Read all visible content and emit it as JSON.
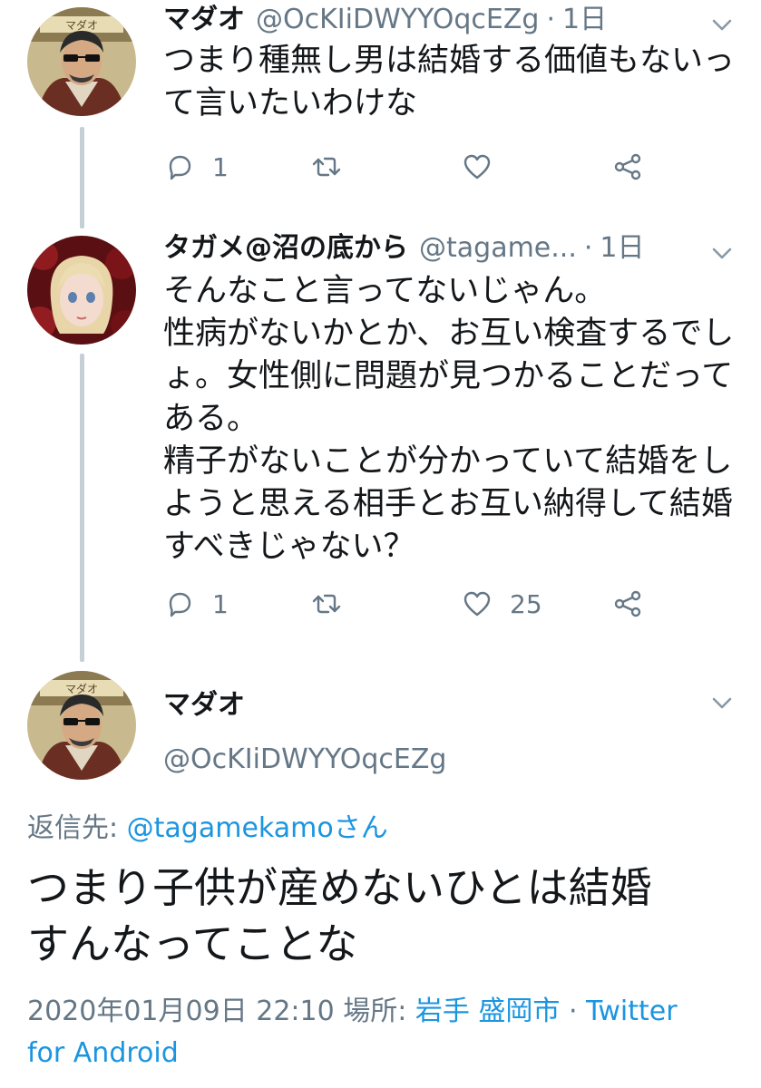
{
  "tweets": [
    {
      "name": "マダオ",
      "handle": "@OcKIiDWYYOqcEZg",
      "time": "1日",
      "lines": [
        "つまり種無し男は結婚する価値もないっ",
        "て言いたいわけな"
      ],
      "replies": "1",
      "likes": ""
    },
    {
      "name": "タガメ@沼の底から",
      "handle": "@tagame...",
      "time": "1日",
      "lines": [
        "そんなこと言ってないじゃん。",
        "性病がないかとか、お互い検査するでし",
        "ょ。女性側に問題が見つかることだって",
        "ある。",
        "精子がないことが分かっていて結婚をし",
        "ようと思える相手とお互い納得して結婚",
        "すべきじゃない？"
      ],
      "replies": "1",
      "likes": "25"
    }
  ],
  "main_tweet": {
    "name": "マダオ",
    "handle": "@OcKIiDWYYOqcEZg",
    "reply_label": "返信先: ",
    "reply_target": "@tagamekamoさん",
    "lines": [
      "つまり子供が産めないひとは結婚",
      "すんなってことな"
    ],
    "date": "2020年01月09日 22:10",
    "place_label": " 場所: ",
    "place": "岩手 盛岡市",
    "separator": " · ",
    "source_line1": "Twitter",
    "source_line2": "for Android"
  },
  "icons": {
    "reply": "reply-icon",
    "retweet": "retweet-icon",
    "like": "heart-icon",
    "share": "share-icon",
    "menu": "chevron-down-icon"
  },
  "colors": {
    "link": "#1b95e0",
    "secondary": "#657786",
    "text": "#14171a",
    "thread_line": "#c4cfd6"
  }
}
